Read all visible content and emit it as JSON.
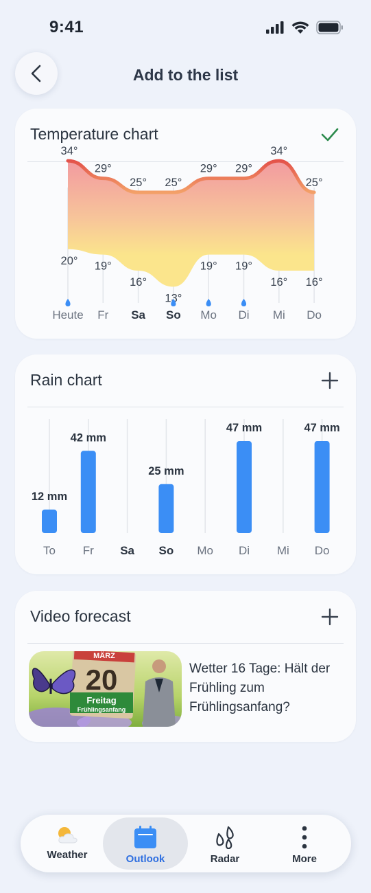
{
  "status": {
    "time": "9:41"
  },
  "header": {
    "title": "Add to the list"
  },
  "temperature_card": {
    "title": "Temperature chart",
    "days": [
      "Heute",
      "Fr",
      "Sa",
      "So",
      "Mo",
      "Di",
      "Mi",
      "Do"
    ],
    "bold_days": [
      "Sa",
      "So"
    ],
    "rain_icon_days": [
      "Heute",
      "So",
      "Mo",
      "Di"
    ],
    "chart_data": {
      "type": "area",
      "categories": [
        "Heute",
        "Fr",
        "Sa",
        "So",
        "Mo",
        "Di",
        "Mi",
        "Do"
      ],
      "series": [
        {
          "values": [
            34,
            29,
            25,
            25,
            29,
            29,
            34,
            25
          ]
        },
        {
          "values": [
            20,
            19,
            16,
            13,
            19,
            19,
            16,
            16
          ]
        }
      ],
      "value_labels_high": [
        "34°",
        "29°",
        "25°",
        "25°",
        "29°",
        "29°",
        "34°",
        "25°"
      ],
      "value_labels_low": [
        "20°",
        "19°",
        "16°",
        "13°",
        "19°",
        "19°",
        "16°",
        "16°"
      ],
      "colors": {
        "high_line": "#e3524a",
        "fill_top": "#f29aa0",
        "fill_bottom": "#fbe58c"
      }
    }
  },
  "rain_card": {
    "title": "Rain chart",
    "bold_days": [
      "Sa",
      "So"
    ],
    "chart_data": {
      "type": "bar",
      "categories": [
        "To",
        "Fr",
        "Sa",
        "So",
        "Mo",
        "Di",
        "Mi",
        "Do"
      ],
      "values": [
        12,
        42,
        0,
        25,
        0,
        47,
        0,
        47
      ],
      "value_labels": [
        "12 mm",
        "42 mm",
        "",
        "25 mm",
        "",
        "47 mm",
        "",
        "47 mm"
      ],
      "color": "#3b8ef5"
    }
  },
  "video_card": {
    "title": "Video forecast",
    "description": "Wetter 16 Tage: Hält der Frühling zum Frühlingsanfang?",
    "thumbnail": {
      "calendar_month": "MÄRZ",
      "calendar_day": "20",
      "calendar_weekday": "Freitag",
      "calendar_caption": "Frühlingsanfang"
    }
  },
  "nav": {
    "items": [
      {
        "label": "Weather",
        "icon": "sun-cloud-icon"
      },
      {
        "label": "Outlook",
        "icon": "calendar-icon"
      },
      {
        "label": "Radar",
        "icon": "raindrops-icon"
      },
      {
        "label": "More",
        "icon": "more-vertical-icon"
      }
    ],
    "active": "Outlook"
  }
}
